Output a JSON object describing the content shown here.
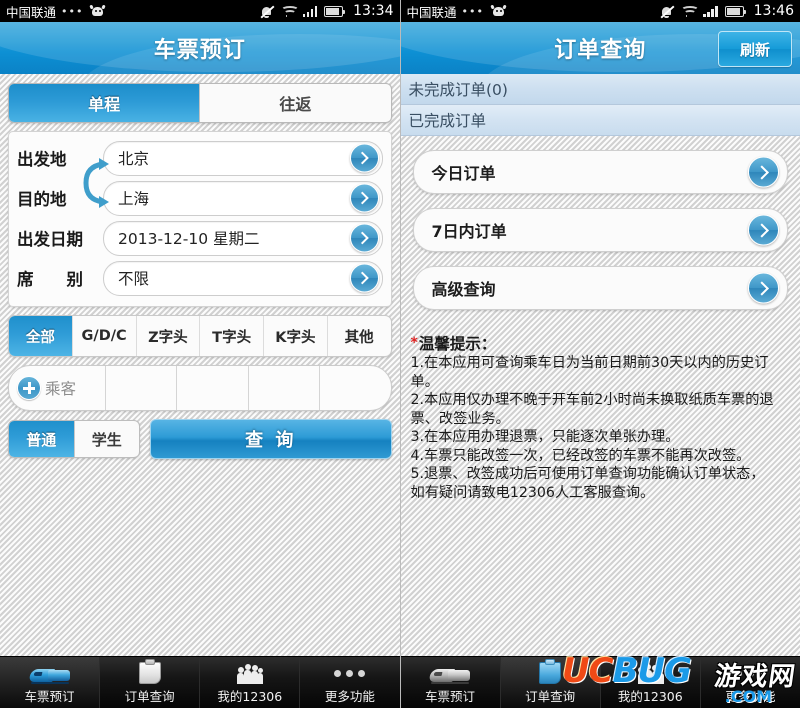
{
  "left": {
    "status_bar": {
      "carrier": "中国联通",
      "dots": "•••",
      "time": "13:34",
      "icons": [
        "mute-icon",
        "wifi-icon",
        "signal-icon",
        "battery-icon",
        "android-robot-icon"
      ]
    },
    "title": "车票预订",
    "trip_tabs": [
      {
        "label": "单程",
        "selected": true
      },
      {
        "label": "往返",
        "selected": false
      }
    ],
    "form": [
      {
        "label": "出发地",
        "value": "北京"
      },
      {
        "label": "目的地",
        "value": "上海"
      },
      {
        "label": "出发日期",
        "value": "2013-12-10 星期二"
      },
      {
        "label": "席　　别",
        "value": "不限"
      }
    ],
    "train_types": [
      {
        "label": "全部",
        "selected": true
      },
      {
        "label": "G/D/C",
        "selected": false
      },
      {
        "label": "Z字头",
        "selected": false
      },
      {
        "label": "T字头",
        "selected": false
      },
      {
        "label": "K字头",
        "selected": false
      },
      {
        "label": "其他",
        "selected": false
      }
    ],
    "passenger": {
      "add_label": "乘客",
      "empty_slots": 4
    },
    "ticket_type": [
      {
        "label": "普通",
        "selected": true
      },
      {
        "label": "学生",
        "selected": false
      }
    ],
    "query_button": "查 询",
    "navbar": [
      {
        "label": "车票预订",
        "icon": "train-icon",
        "active": true
      },
      {
        "label": "订单查询",
        "icon": "clipboard-icon",
        "active": false
      },
      {
        "label": "我的12306",
        "icon": "people-icon",
        "active": false
      },
      {
        "label": "更多功能",
        "icon": "ellipsis-icon",
        "active": false
      }
    ]
  },
  "right": {
    "status_bar": {
      "carrier": "中国联通",
      "dots": "•••",
      "time": "13:46"
    },
    "title": "订单查询",
    "refresh_label": "刷新",
    "sections": [
      {
        "label": "未完成订单(0)"
      },
      {
        "label": "已完成订单"
      }
    ],
    "order_buttons": [
      {
        "label": "今日订单"
      },
      {
        "label": "7日内订单"
      },
      {
        "label": "高级查询"
      }
    ],
    "tips": {
      "star": "*",
      "title": "温馨提示：",
      "lines": [
        "1.在本应用可查询乘车日为当前日期前30天以内的历史订",
        "单。",
        "2.本应用仅办理不晚于开车前2小时尚未换取纸质车票的退",
        "票、改签业务。",
        "3.在本应用办理退票，只能逐次单张办理。",
        "4.车票只能改签一次，已经改签的车票不能再次改签。",
        "5.退票、改签成功后可使用订单查询功能确认订单状态，",
        "如有疑问请致电12306人工客服查询。"
      ]
    },
    "navbar": [
      {
        "label": "车票预订",
        "icon": "train-icon",
        "active": false
      },
      {
        "label": "订单查询",
        "icon": "clipboard-icon",
        "active": true
      },
      {
        "label": "我的12306",
        "icon": "people-icon",
        "active": false
      },
      {
        "label": "更多功能",
        "icon": "ellipsis-icon",
        "active": false
      }
    ]
  },
  "watermark": {
    "uc": "UC",
    "bug": "BUG",
    "cn": "游戏网",
    "com": ".COM"
  },
  "colors": {
    "accent": "#0d8bcd",
    "header_top": "#3fa9dd",
    "header_bottom": "#0b82c6",
    "tips_star": "#e02020"
  }
}
